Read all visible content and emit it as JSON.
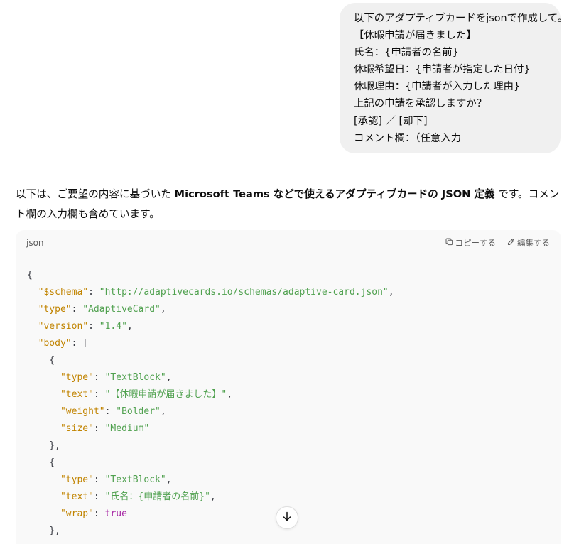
{
  "user_message": {
    "lines": [
      "以下のアダプティブカードをjsonで作成して。",
      "【休暇申請が届きました】",
      "氏名：{申請者の名前}",
      "休暇希望日：{申請者が指定した日付}",
      "休暇理由：{申請者が入力した理由}",
      "上記の申請を承認しますか？",
      "[承認] ／ [却下]",
      "コメント欄：（任意入力"
    ]
  },
  "assistant_reply": {
    "intro_before": "以下は、ご要望の内容に基づいた ",
    "intro_bold": "Microsoft Teams などで使えるアダプティブカードの JSON 定義",
    "intro_after": " です。コメント欄の入力欄も含めています。"
  },
  "code_block": {
    "language": "json",
    "copy_label": "コピーする",
    "edit_label": "編集する",
    "lines": [
      [
        {
          "t": "p",
          "v": "{"
        }
      ],
      [
        {
          "t": "p",
          "v": "  "
        },
        {
          "t": "k",
          "v": "\"$schema\""
        },
        {
          "t": "p",
          "v": ": "
        },
        {
          "t": "s",
          "v": "\"http://adaptivecards.io/schemas/adaptive-card.json\""
        },
        {
          "t": "p",
          "v": ","
        }
      ],
      [
        {
          "t": "p",
          "v": "  "
        },
        {
          "t": "k",
          "v": "\"type\""
        },
        {
          "t": "p",
          "v": ": "
        },
        {
          "t": "s",
          "v": "\"AdaptiveCard\""
        },
        {
          "t": "p",
          "v": ","
        }
      ],
      [
        {
          "t": "p",
          "v": "  "
        },
        {
          "t": "k",
          "v": "\"version\""
        },
        {
          "t": "p",
          "v": ": "
        },
        {
          "t": "s",
          "v": "\"1.4\""
        },
        {
          "t": "p",
          "v": ","
        }
      ],
      [
        {
          "t": "p",
          "v": "  "
        },
        {
          "t": "k",
          "v": "\"body\""
        },
        {
          "t": "p",
          "v": ": ["
        }
      ],
      [
        {
          "t": "p",
          "v": "    {"
        }
      ],
      [
        {
          "t": "p",
          "v": "      "
        },
        {
          "t": "k",
          "v": "\"type\""
        },
        {
          "t": "p",
          "v": ": "
        },
        {
          "t": "s",
          "v": "\"TextBlock\""
        },
        {
          "t": "p",
          "v": ","
        }
      ],
      [
        {
          "t": "p",
          "v": "      "
        },
        {
          "t": "k",
          "v": "\"text\""
        },
        {
          "t": "p",
          "v": ": "
        },
        {
          "t": "s",
          "v": "\"【休暇申請が届きました】\""
        },
        {
          "t": "p",
          "v": ","
        }
      ],
      [
        {
          "t": "p",
          "v": "      "
        },
        {
          "t": "k",
          "v": "\"weight\""
        },
        {
          "t": "p",
          "v": ": "
        },
        {
          "t": "s",
          "v": "\"Bolder\""
        },
        {
          "t": "p",
          "v": ","
        }
      ],
      [
        {
          "t": "p",
          "v": "      "
        },
        {
          "t": "k",
          "v": "\"size\""
        },
        {
          "t": "p",
          "v": ": "
        },
        {
          "t": "s",
          "v": "\"Medium\""
        }
      ],
      [
        {
          "t": "p",
          "v": "    },"
        }
      ],
      [
        {
          "t": "p",
          "v": "    {"
        }
      ],
      [
        {
          "t": "p",
          "v": "      "
        },
        {
          "t": "k",
          "v": "\"type\""
        },
        {
          "t": "p",
          "v": ": "
        },
        {
          "t": "s",
          "v": "\"TextBlock\""
        },
        {
          "t": "p",
          "v": ","
        }
      ],
      [
        {
          "t": "p",
          "v": "      "
        },
        {
          "t": "k",
          "v": "\"text\""
        },
        {
          "t": "p",
          "v": ": "
        },
        {
          "t": "s",
          "v": "\"氏名：{申請者の名前}\""
        },
        {
          "t": "p",
          "v": ","
        }
      ],
      [
        {
          "t": "p",
          "v": "      "
        },
        {
          "t": "k",
          "v": "\"wrap\""
        },
        {
          "t": "p",
          "v": ": "
        },
        {
          "t": "n",
          "v": "true"
        }
      ],
      [
        {
          "t": "p",
          "v": "    },"
        }
      ]
    ]
  },
  "colors": {
    "bubble_bg": "#f0f0f0",
    "code_bg": "#f9f9f9",
    "json_key": "#c18401",
    "json_string": "#50a14f",
    "json_keyword": "#a626a4"
  },
  "icons": {
    "copy": "copy-icon",
    "edit": "pencil-icon",
    "scroll": "arrow-down-icon"
  }
}
